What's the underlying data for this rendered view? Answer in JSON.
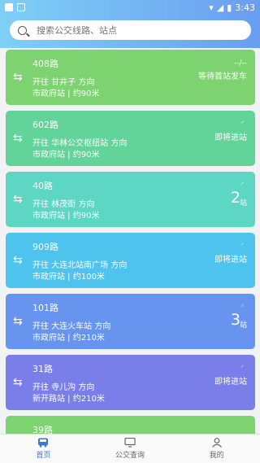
{
  "status_bar": {
    "time": "3:43"
  },
  "search": {
    "placeholder": "搜索公交线路、站点"
  },
  "cards": [
    {
      "route": "408路",
      "direction": "开往 甘井子 方向",
      "stop": "市政府站 | 约90米",
      "status": "等待首站发车",
      "extra": "--/--",
      "color": "#7dd36f"
    },
    {
      "route": "602路",
      "direction": "开往 华林公交枢纽站 方向",
      "stop": "市政府站 | 约90米",
      "status": "即将进站",
      "color": "#62d49a"
    },
    {
      "route": "40路",
      "direction": "开往 林茂街 方向",
      "stop": "市政府站 | 约90米",
      "count": "2",
      "unit": "站",
      "color": "#5dd6c4"
    },
    {
      "route": "909路",
      "direction": "开往 大连北站南广场 方向",
      "stop": "市政府站 | 约100米",
      "status": "即将进站",
      "color": "#4ec3ee"
    },
    {
      "route": "101路",
      "direction": "开往 大连火车站 方向",
      "stop": "市政府站 | 约210米",
      "count": "3",
      "unit": "站",
      "color": "#6694ef"
    },
    {
      "route": "31路",
      "direction": "开往 寺儿沟 方向",
      "stop": "新开路站 | 约210米",
      "status": "即将进站",
      "color": "#7a7ee9"
    },
    {
      "route": "39路",
      "direction": "",
      "stop": "",
      "color": "#7dd36f"
    }
  ],
  "tabs": [
    {
      "label": "首页",
      "icon": "bus-icon",
      "active": true
    },
    {
      "label": "公交查询",
      "icon": "monitor-icon",
      "active": false
    },
    {
      "label": "我的",
      "icon": "user-icon",
      "active": false
    }
  ]
}
